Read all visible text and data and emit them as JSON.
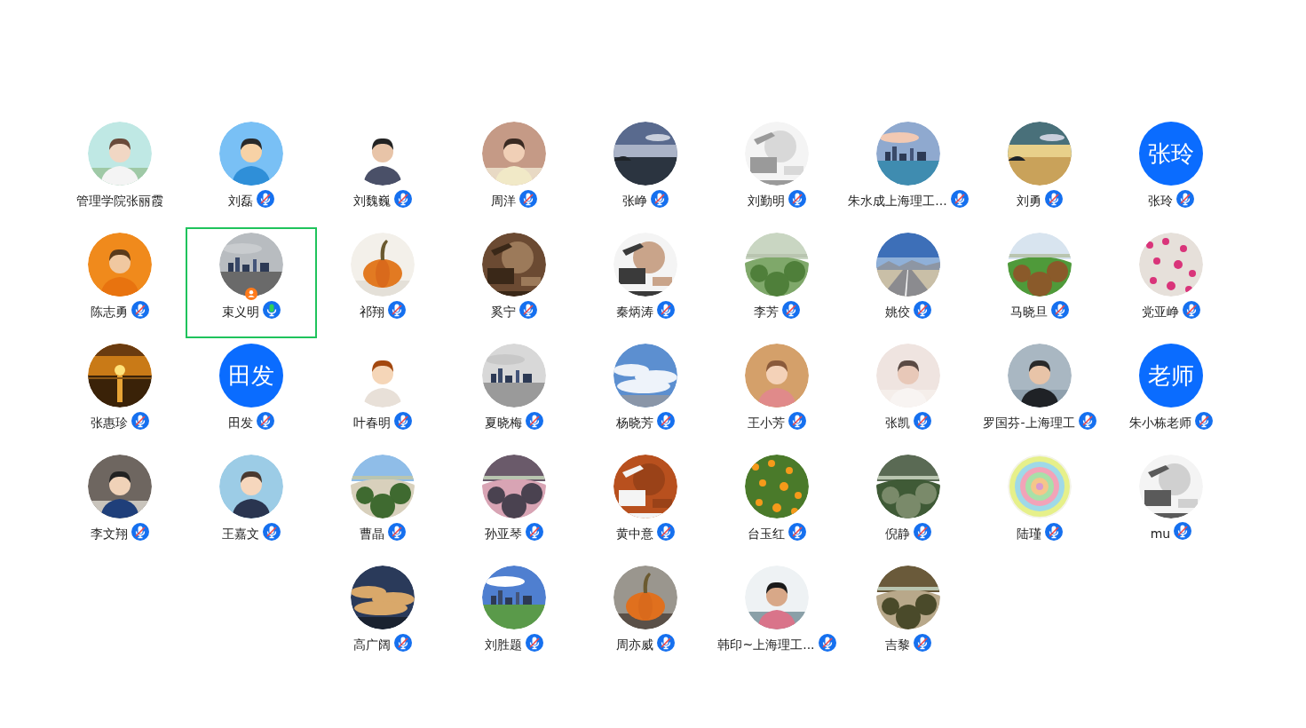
{
  "participants": [
    {
      "name": "管理学院张丽霞",
      "host": false,
      "selected": false
    },
    {
      "name": "刘磊",
      "mic_muted": true,
      "host": false,
      "selected": false
    },
    {
      "name": "刘魏巍",
      "mic_muted": true,
      "host": false,
      "selected": false
    },
    {
      "name": "周洋",
      "mic_muted": true,
      "host": false,
      "selected": false
    },
    {
      "name": "张峥",
      "mic_muted": true,
      "host": false,
      "selected": false
    },
    {
      "name": "刘勤明",
      "mic_muted": true,
      "host": false,
      "selected": false
    },
    {
      "name": "朱水成上海理工...",
      "mic_muted": true,
      "host": false,
      "selected": false
    },
    {
      "name": "刘勇",
      "mic_muted": true,
      "host": false,
      "selected": false
    },
    {
      "name": "张玲",
      "avatar": {
        "kind": "text",
        "text": "张玲"
      },
      "mic_muted": true,
      "host": false,
      "selected": false
    },
    {
      "name": "陈志勇",
      "mic_muted": true,
      "host": false,
      "selected": false
    },
    {
      "name": "束义明",
      "mic_muted": false,
      "host": true,
      "selected": true
    },
    {
      "name": "祁翔",
      "mic_muted": true,
      "host": false,
      "selected": false
    },
    {
      "name": "奚宁",
      "mic_muted": true,
      "host": false,
      "selected": false
    },
    {
      "name": "秦炳涛",
      "mic_muted": true,
      "host": false,
      "selected": false
    },
    {
      "name": "李芳",
      "mic_muted": true,
      "host": false,
      "selected": false
    },
    {
      "name": "姚佼",
      "mic_muted": true,
      "host": false,
      "selected": false
    },
    {
      "name": "马晓旦",
      "mic_muted": true,
      "host": false,
      "selected": false
    },
    {
      "name": "党亚峥",
      "mic_muted": true,
      "host": false,
      "selected": false
    },
    {
      "name": "张惠珍",
      "mic_muted": true,
      "host": false,
      "selected": false
    },
    {
      "name": "田发",
      "avatar": {
        "kind": "text",
        "text": "田发"
      },
      "mic_muted": true,
      "host": false,
      "selected": false
    },
    {
      "name": "叶春明",
      "mic_muted": true,
      "host": false,
      "selected": false
    },
    {
      "name": "夏晓梅",
      "mic_muted": true,
      "host": false,
      "selected": false
    },
    {
      "name": "杨晓芳",
      "mic_muted": true,
      "host": false,
      "selected": false
    },
    {
      "name": "王小芳",
      "mic_muted": true,
      "host": false,
      "selected": false
    },
    {
      "name": "张凯",
      "mic_muted": true,
      "host": false,
      "selected": false
    },
    {
      "name": "罗国芬-上海理工",
      "mic_muted": true,
      "host": false,
      "selected": false
    },
    {
      "name": "朱小栋老师",
      "avatar": {
        "kind": "text",
        "text": "老师"
      },
      "mic_muted": true,
      "host": false,
      "selected": false
    },
    {
      "name": "李文翔",
      "mic_muted": true,
      "host": false,
      "selected": false
    },
    {
      "name": "王嘉文",
      "mic_muted": true,
      "host": false,
      "selected": false
    },
    {
      "name": "曹晶",
      "mic_muted": true,
      "host": false,
      "selected": false
    },
    {
      "name": "孙亚琴",
      "mic_muted": true,
      "host": false,
      "selected": false
    },
    {
      "name": "黄中意",
      "mic_muted": true,
      "host": false,
      "selected": false
    },
    {
      "name": "台玉红",
      "mic_muted": true,
      "host": false,
      "selected": false
    },
    {
      "name": "倪静",
      "mic_muted": true,
      "host": false,
      "selected": false
    },
    {
      "name": "陆瑾",
      "mic_muted": true,
      "host": false,
      "selected": false
    },
    {
      "name": "mu",
      "mic_muted": true,
      "host": false,
      "selected": false
    },
    {
      "name": "高广阔",
      "mic_muted": true,
      "host": false,
      "selected": false
    },
    {
      "name": "刘胜题",
      "mic_muted": true,
      "host": false,
      "selected": false
    },
    {
      "name": "周亦威",
      "mic_muted": true,
      "host": false,
      "selected": false
    },
    {
      "name": "韩印~上海理工...",
      "mic_muted": true,
      "host": false,
      "selected": false
    },
    {
      "name": "吉黎",
      "mic_muted": true,
      "host": false,
      "selected": false
    }
  ]
}
